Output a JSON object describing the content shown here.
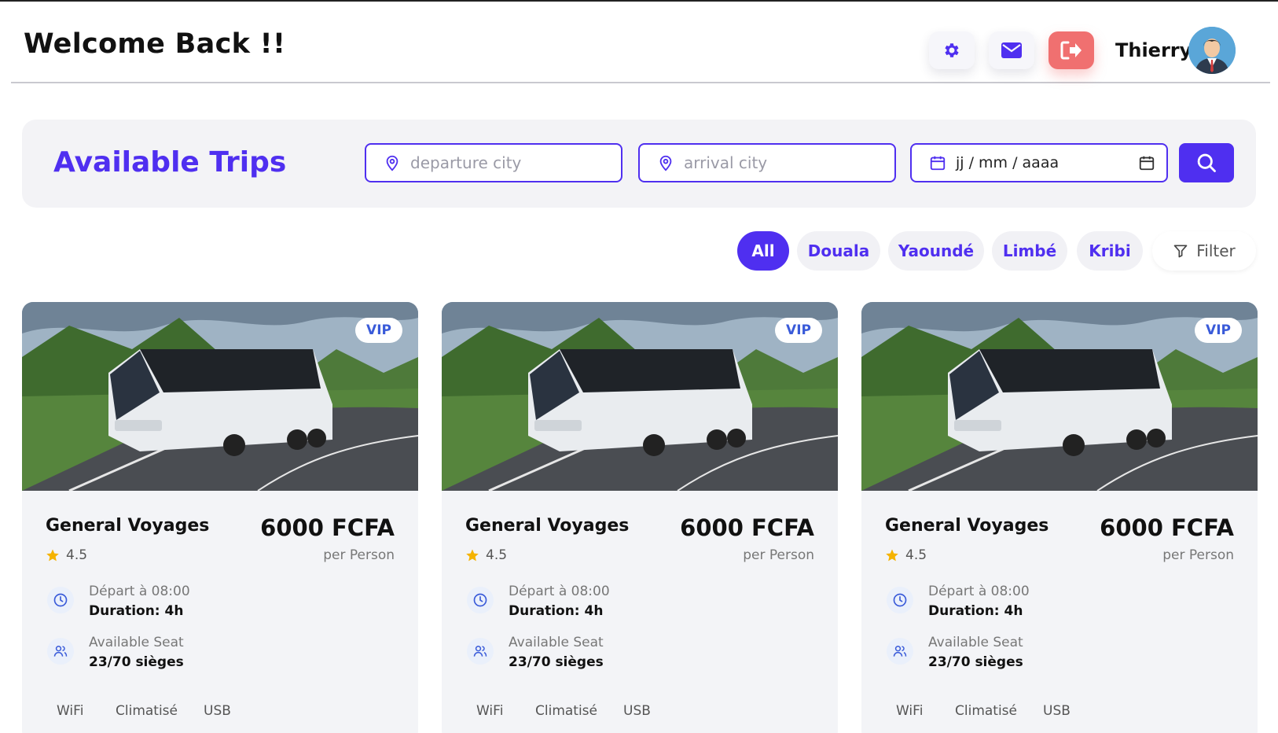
{
  "header": {
    "welcome": "Welcome Back !!",
    "username": "Thierry",
    "icons": [
      "gear-icon",
      "envelope-icon",
      "logout-icon"
    ]
  },
  "search": {
    "title": "Available Trips",
    "departure_placeholder": "departure city",
    "arrival_placeholder": "arrival city",
    "date_placeholder": "jj / mm / aaaa"
  },
  "filters": {
    "chips": [
      "All",
      "Douala",
      "Yaoundé",
      "Limbé",
      "Kribi"
    ],
    "active": "All",
    "filter_label": "Filter"
  },
  "colors": {
    "accent": "#4f2ff0",
    "logout": "#f07070",
    "star": "#f5b301"
  },
  "trips": [
    {
      "badge": "VIP",
      "operator": "General Voyages",
      "rating": "4.5",
      "price": "6000 FCFA",
      "per": "per Person",
      "departure": "Départ à 08:00",
      "duration": "Duration: 4h",
      "seats_label": "Available Seat",
      "seats": "23/70 sièges",
      "amenities": [
        "WiFi",
        "Climatisé",
        "USB"
      ]
    },
    {
      "badge": "VIP",
      "operator": "General Voyages",
      "rating": "4.5",
      "price": "6000 FCFA",
      "per": "per Person",
      "departure": "Départ à 08:00",
      "duration": "Duration: 4h",
      "seats_label": "Available Seat",
      "seats": "23/70 sièges",
      "amenities": [
        "WiFi",
        "Climatisé",
        "USB"
      ]
    },
    {
      "badge": "VIP",
      "operator": "General Voyages",
      "rating": "4.5",
      "price": "6000 FCFA",
      "per": "per Person",
      "departure": "Départ à 08:00",
      "duration": "Duration: 4h",
      "seats_label": "Available Seat",
      "seats": "23/70 sièges",
      "amenities": [
        "WiFi",
        "Climatisé",
        "USB"
      ]
    }
  ]
}
